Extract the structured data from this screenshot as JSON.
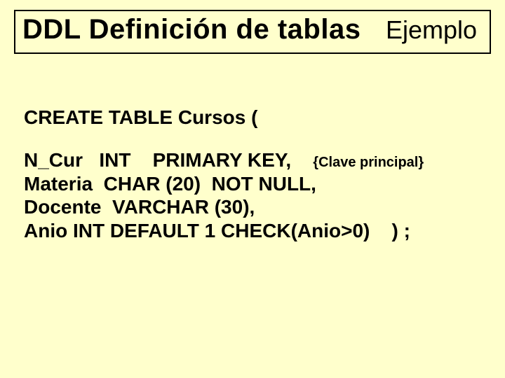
{
  "title": {
    "main": "DDL  Definición de tablas",
    "sub": "Ejemplo"
  },
  "code": {
    "create": "CREATE TABLE Cursos  (",
    "line1_col": "N_Cur   INT    PRIMARY KEY,    ",
    "line1_comment": "{Clave principal}",
    "line2": "Materia  CHAR (20)  NOT NULL,",
    "line3": "Docente  VARCHAR (30),",
    "line4": "Anio INT DEFAULT 1 CHECK(Anio>0)    ) ;"
  }
}
